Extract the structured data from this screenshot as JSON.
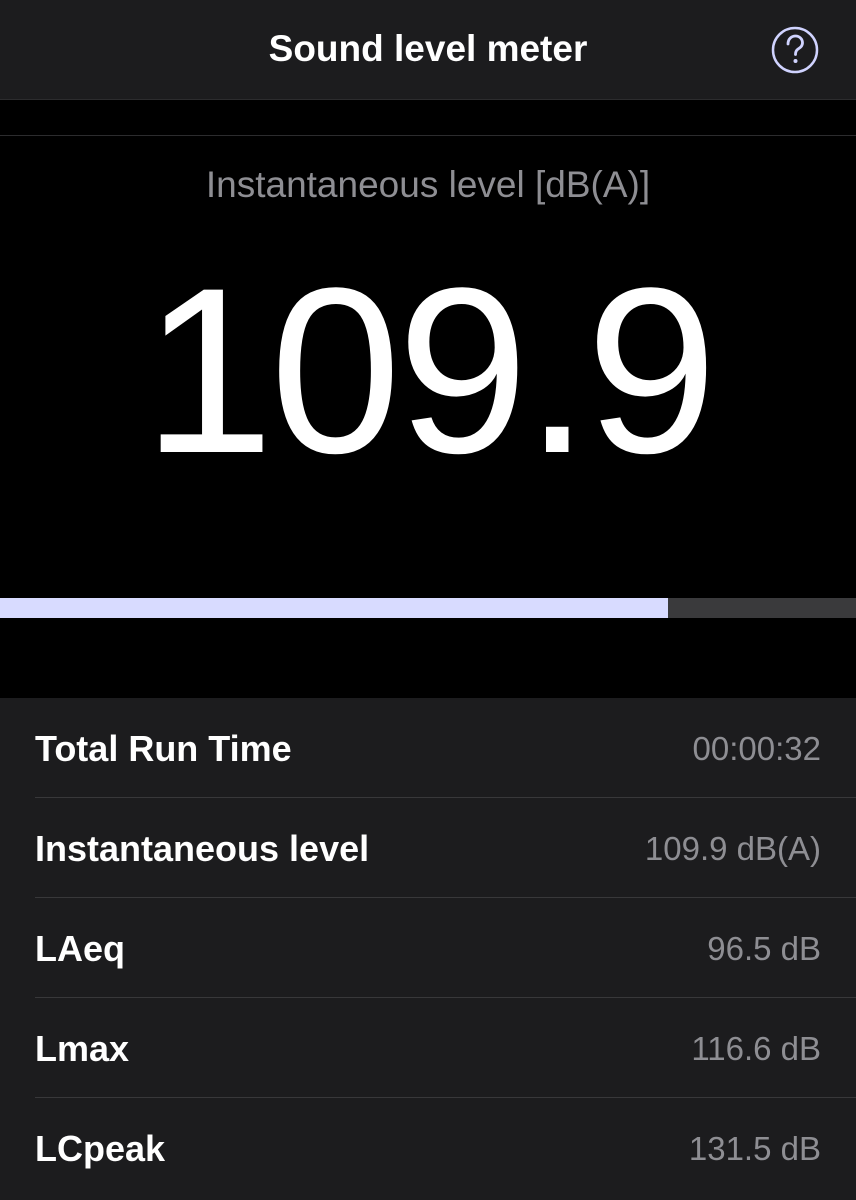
{
  "navbar": {
    "title": "Sound level meter",
    "help_icon": "question-circle-icon"
  },
  "meter": {
    "label": "Instantaneous level [dB(A)]",
    "value": "109.9",
    "level_fraction": 0.78
  },
  "colors": {
    "background": "#000000",
    "navbar": "#1c1c1e",
    "bar_fill": "#d8dbff",
    "bar_track": "#3a3a3c",
    "secondary_text": "#8e8e93"
  },
  "stats": [
    {
      "label": "Total Run Time",
      "value": "00:00:32"
    },
    {
      "label": "Instantaneous level",
      "value": "109.9 dB(A)"
    },
    {
      "label": "LAeq",
      "value": "96.5 dB"
    },
    {
      "label": "Lmax",
      "value": "116.6 dB"
    },
    {
      "label": "LCpeak",
      "value": "131.5 dB"
    }
  ]
}
